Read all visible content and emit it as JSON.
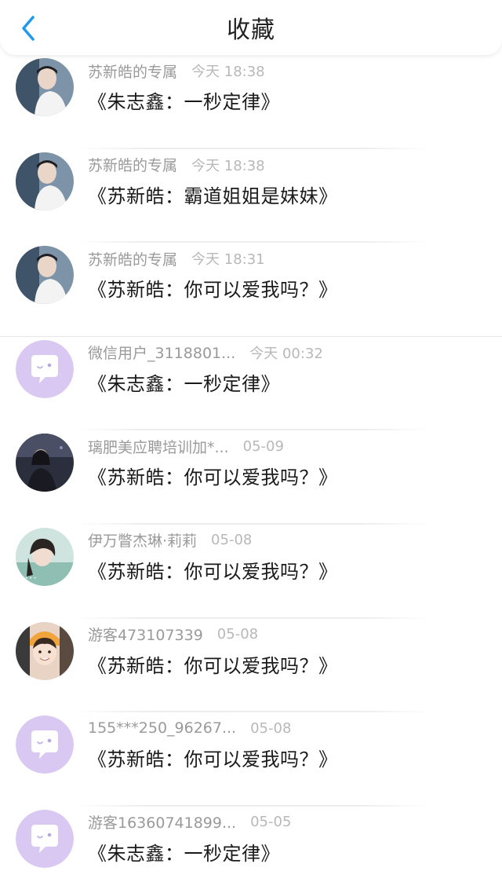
{
  "header": {
    "title": "收藏",
    "back_icon": "chevron-left-icon",
    "accent_color": "#1e9bf0"
  },
  "favorites": [
    {
      "sender": "苏新皓的专属",
      "time": "今天 18:38",
      "content": "《朱志鑫：一秒定律》",
      "avatar": "photo-boy-white-shirt"
    },
    {
      "sender": "苏新皓的专属",
      "time": "今天 18:38",
      "content": "《苏新皓：霸道姐姐是妹妹》",
      "avatar": "photo-boy-white-shirt"
    },
    {
      "sender": "苏新皓的专属",
      "time": "今天 18:31",
      "content": "《苏新皓：你可以爱我吗？》",
      "avatar": "photo-boy-white-shirt"
    },
    {
      "sender": "微信用户_3118801...",
      "time": "今天 00:32",
      "content": "《朱志鑫：一秒定律》",
      "avatar": "default-chat-bubble"
    },
    {
      "sender": "璃肥美应聘培训加*...",
      "time": "05-09",
      "content": "《苏新皓：你可以爱我吗？》",
      "avatar": "photo-dark-night"
    },
    {
      "sender": "伊万瞥杰琳·莉莉",
      "time": "05-08",
      "content": "《苏新皓：你可以爱我吗？》",
      "avatar": "photo-girl-teal"
    },
    {
      "sender": "游客473107339",
      "time": "05-08",
      "content": "《苏新皓：你可以爱我吗？》",
      "avatar": "photo-child-smiling"
    },
    {
      "sender": "155***250_96267...",
      "time": "05-08",
      "content": "《苏新皓：你可以爱我吗？》",
      "avatar": "default-chat-bubble"
    },
    {
      "sender": "游客16360741899...",
      "time": "05-05",
      "content": "《朱志鑫：一秒定律》",
      "avatar": "default-chat-bubble"
    }
  ],
  "colors": {
    "sender_text": "#9a9a9a",
    "time_text": "#b8b8b8",
    "content_text": "#1a1a1a",
    "default_avatar_bg": "#d8c8f2"
  }
}
